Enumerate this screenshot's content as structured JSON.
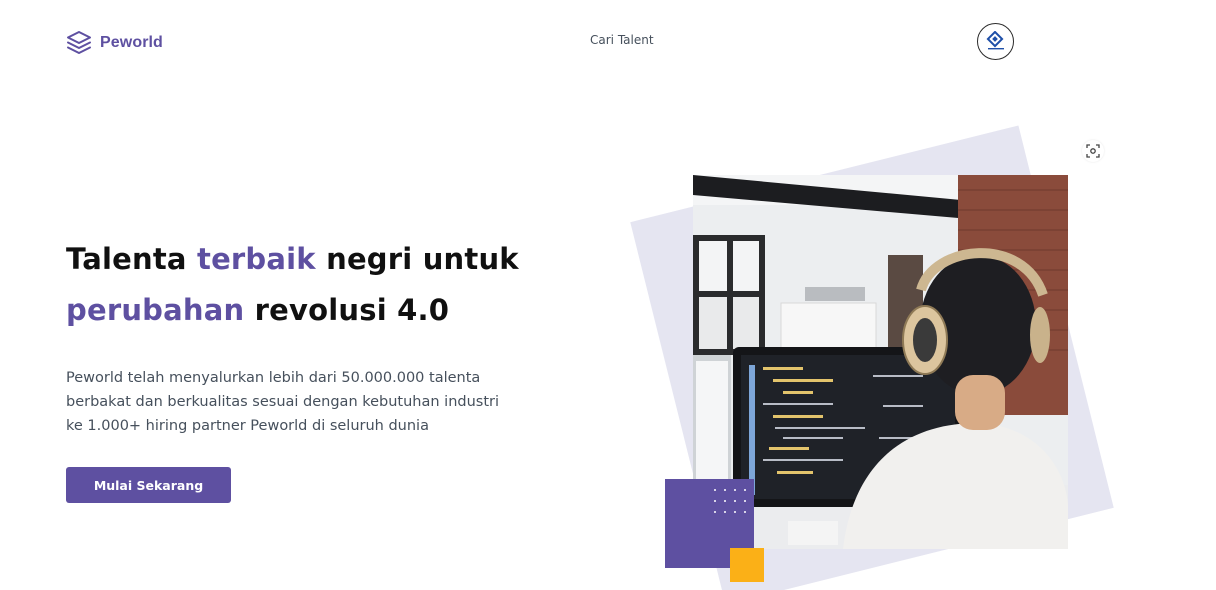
{
  "header": {
    "brand": "Peworld",
    "nav_link": "Cari Talent"
  },
  "hero": {
    "headline": {
      "part1": "Talenta ",
      "accent1": "terbaik",
      "part2": " negri untuk ",
      "accent2": "perubahan",
      "part3": " revolusi 4.0"
    },
    "description": "Peworld telah menyalurkan lebih dari 50.000.000 talenta berbakat dan berkualitas sesuai dengan kebutuhan industri ke 1.000+ hiring partner Peworld di seluruh dunia",
    "cta_label": "Mulai Sekarang"
  },
  "colors": {
    "brand_purple": "#5e50a1",
    "accent_yellow": "#fbb017",
    "shape_gray": "#e5e5f1",
    "body_text": "#46505c"
  },
  "icons": {
    "logo": "stacked-layers-icon",
    "scan": "scan-focus-icon"
  }
}
